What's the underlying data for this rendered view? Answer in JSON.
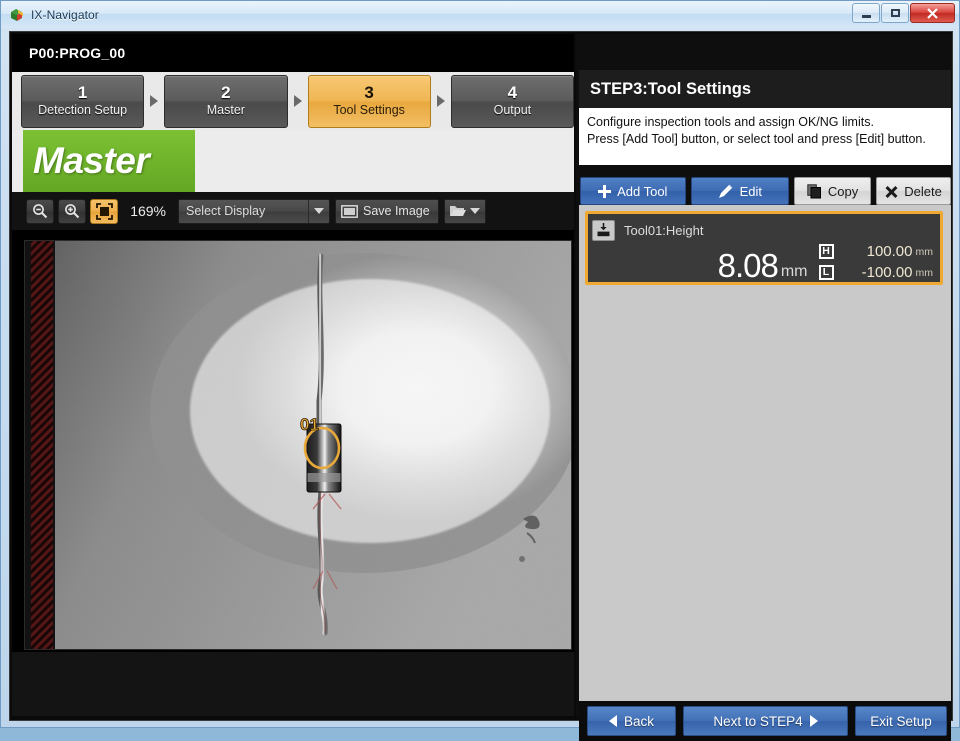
{
  "window": {
    "title": "IX-Navigator",
    "icon": "app-cube-icon",
    "controls": {
      "minimize": "–",
      "maximize": "□",
      "close": "✕"
    }
  },
  "program": {
    "label": "P00:PROG_00"
  },
  "steps": [
    {
      "num": "1",
      "name": "Detection Setup",
      "active": false
    },
    {
      "num": "2",
      "name": "Master",
      "active": false
    },
    {
      "num": "3",
      "name": "Tool Settings",
      "active": true
    },
    {
      "num": "4",
      "name": "Output",
      "active": false
    }
  ],
  "master_badge": {
    "label": "Master",
    "color": "#6fb42b"
  },
  "image_toolbar": {
    "zoom_out_icon": "zoom-out-icon",
    "zoom_in_icon": "zoom-in-icon",
    "fit_icon": "fit-to-window-icon",
    "zoom_level": "169%",
    "select_display": {
      "value": "Select Display",
      "placeholder": "Select Display"
    },
    "save_image": {
      "label": "Save Image",
      "icon": "image-icon"
    },
    "folder": {
      "icon": "folder-open-icon"
    }
  },
  "inspection_image": {
    "marker_label": "01",
    "marker_color": "#e8a93a"
  },
  "right_panel": {
    "title": "STEP3:Tool Settings",
    "description_line1": "Configure inspection tools and assign OK/NG limits.",
    "description_line2": "Press [Add Tool] button, or select tool and press [Edit] button.",
    "actions": [
      {
        "label": "Add Tool",
        "icon": "plus-icon",
        "style": "blue"
      },
      {
        "label": "Edit",
        "icon": "pencil-icon",
        "style": "blue"
      },
      {
        "label": "Copy",
        "icon": "copy-icon",
        "style": "gray"
      },
      {
        "label": "Delete",
        "icon": "x-icon",
        "style": "gray"
      }
    ],
    "tool_card": {
      "icon": "height-tool-icon",
      "name": "Tool01:Height",
      "value": "8.08",
      "unit": "mm",
      "high_key": "H",
      "high_value": "100.00",
      "high_unit": "mm",
      "low_key": "L",
      "low_value": "-100.00",
      "low_unit": "mm",
      "selected_border_color": "#efa933"
    }
  },
  "footer": {
    "back": "Back",
    "next": "Next to STEP4",
    "exit": "Exit Setup"
  }
}
